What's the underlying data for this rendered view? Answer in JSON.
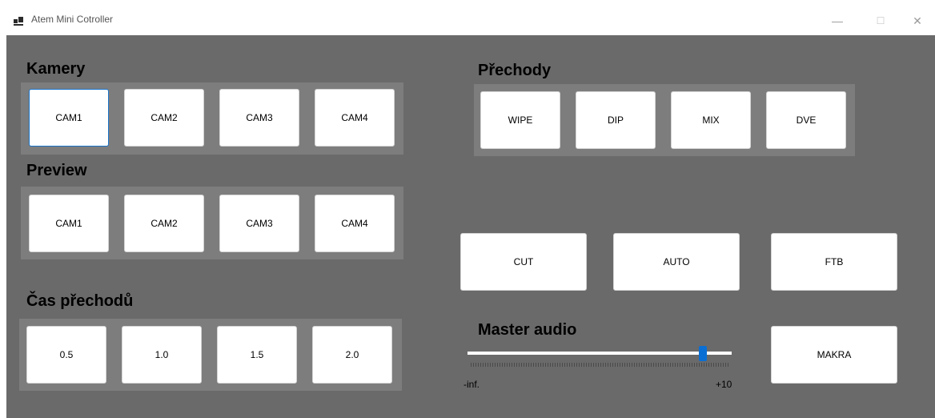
{
  "window": {
    "title": "Atem Mini Cotroller",
    "controls": {
      "minimize": "—",
      "maximize": "☐",
      "close": "✕"
    }
  },
  "kamery": {
    "heading": "Kamery",
    "buttons": [
      "CAM1",
      "CAM2",
      "CAM3",
      "CAM4"
    ]
  },
  "preview": {
    "heading": "Preview",
    "buttons": [
      "CAM1",
      "CAM2",
      "CAM3",
      "CAM4"
    ]
  },
  "cas": {
    "heading": "Čas přechodů",
    "buttons": [
      "0.5",
      "1.0",
      "1.5",
      "2.0"
    ]
  },
  "prechody": {
    "heading": "Přechody",
    "buttons": [
      "WIPE",
      "DIP",
      "MIX",
      "DVE"
    ]
  },
  "actions": {
    "cut": "CUT",
    "auto": "AUTO",
    "ftb": "FTB",
    "makra": "MAKRA"
  },
  "audio": {
    "heading": "Master audio",
    "min_label": "-inf.",
    "max_label": "+10",
    "level_fraction": 0.89
  },
  "colors": {
    "active_border": "#1a73c9",
    "slider_thumb": "#0a6fd4",
    "panel": "#7d7d7d",
    "background": "#6a6a6a"
  }
}
